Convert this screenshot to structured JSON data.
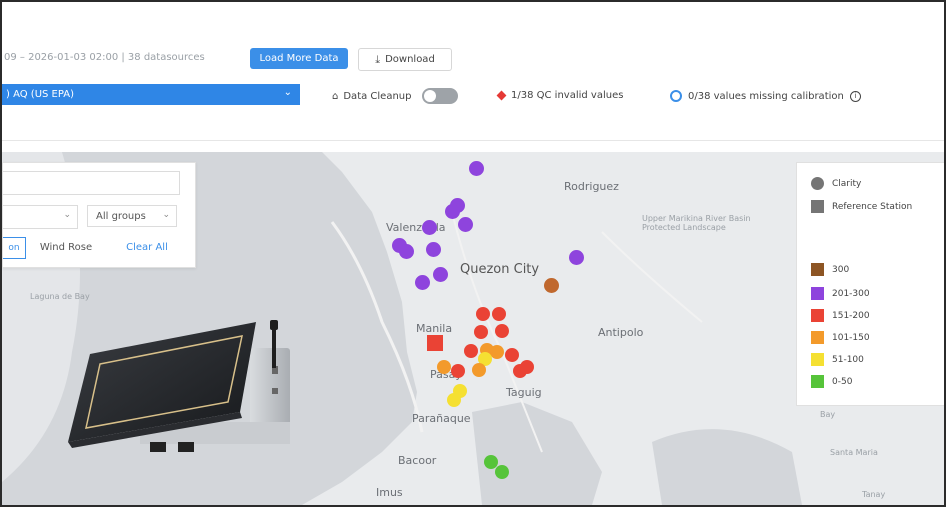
{
  "toolbar": {
    "date_range": "09 – 2026-01-03 02:00 | 38 datasources",
    "load_more_label": "Load More Data",
    "download_label": "Download",
    "download_icon": "download-icon"
  },
  "selector": {
    "value": ") AQ (US EPA)",
    "icon": "chevron-down-icon"
  },
  "data_cleanup": {
    "label": "Data Cleanup",
    "icon": "cleanup-icon",
    "toggle_on": false
  },
  "status": {
    "qc_invalid": "1/38 QC invalid values",
    "missing_calibration": "0/38 values missing calibration"
  },
  "filter_panel": {
    "group_select": "All groups",
    "btn_active": "on",
    "wind_rose_label": "Wind Rose",
    "clear_all_label": "Clear All"
  },
  "map_labels": {
    "rodriguez": "Rodriguez",
    "valenzuela": "Valenzuela",
    "quezon_city": "Quezon City",
    "manila": "Manila",
    "antipolo": "Antipolo",
    "pasay": "Pasay",
    "taguig": "Taguig",
    "paranaque": "Parañaque",
    "bacoor": "Bacoor",
    "imus": "Imus",
    "park_note": "Upper Marikina River Basin Protected Landscape",
    "bay_note": "Laguna de Bay",
    "east_note": "Bay",
    "se_note": "Santa Maria",
    "se_small": "Tanay"
  },
  "legend": {
    "clarity_label": "Clarity",
    "reference_label": "Reference Station",
    "scale": [
      {
        "label": "300",
        "color": "#8d5524"
      },
      {
        "label": "201-300",
        "color": "#8e44dd"
      },
      {
        "label": "151-200",
        "color": "#ea4335"
      },
      {
        "label": "101-150",
        "color": "#f39a2b"
      },
      {
        "label": "51-100",
        "color": "#f5e032"
      },
      {
        "label": "0-50",
        "color": "#56c43a"
      }
    ]
  },
  "colors": {
    "accent": "#3b8fe8",
    "aqi_purple": "#8e44dd",
    "aqi_red": "#ea4335",
    "aqi_orange": "#f39a2b",
    "aqi_yellow": "#f5e032",
    "aqi_green": "#56c43a",
    "aqi_brown": "#c0682e"
  }
}
